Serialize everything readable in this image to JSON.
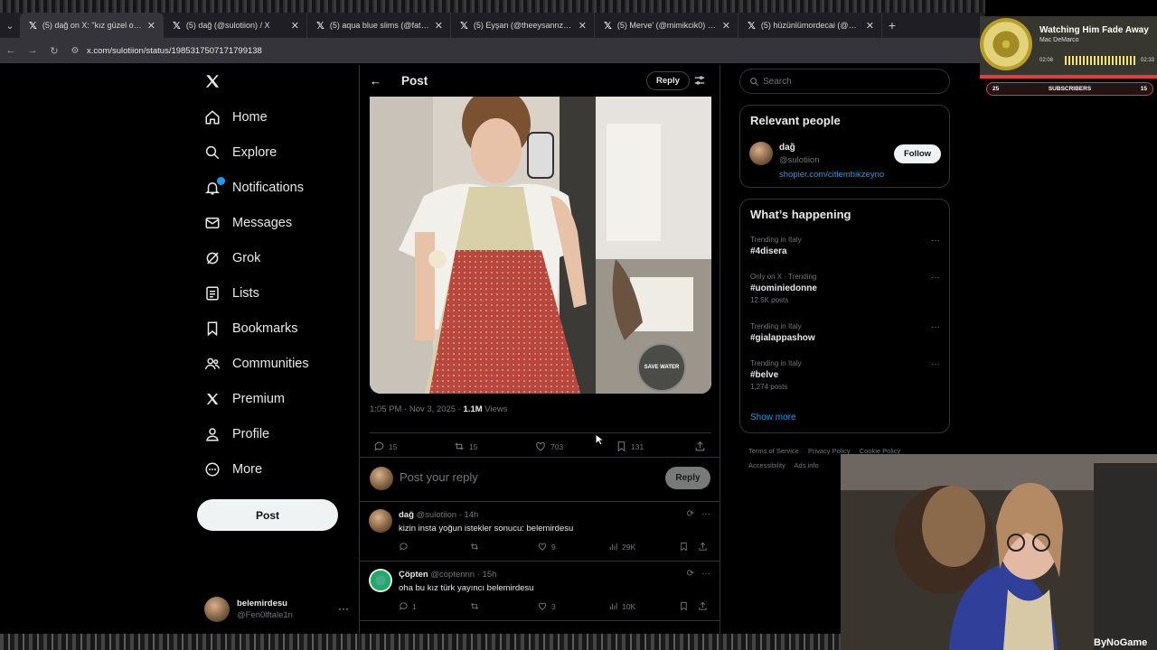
{
  "browser": {
    "tabs": [
      {
        "title": "(5) dağ on X: \"kız güzel olduğu",
        "active": true
      },
      {
        "title": "(5) dağ (@sulotiion) / X",
        "active": false
      },
      {
        "title": "(5) aqua blue slims (@fatosoni",
        "active": false
      },
      {
        "title": "(5) Eyşan (@theeysannz) / X",
        "active": false
      },
      {
        "title": "(5) Merve' (@mimikcik0) / X",
        "active": false
      },
      {
        "title": "(5) hüzünlümordecai (@melan",
        "active": false
      }
    ],
    "url": "x.com/sulotiion/status/1985317507171799138"
  },
  "nav": {
    "items": [
      {
        "label": "Home",
        "icon": "home-icon"
      },
      {
        "label": "Explore",
        "icon": "search-icon"
      },
      {
        "label": "Notifications",
        "icon": "bell-icon"
      },
      {
        "label": "Messages",
        "icon": "mail-icon"
      },
      {
        "label": "Grok",
        "icon": "grok-icon"
      },
      {
        "label": "Lists",
        "icon": "list-icon"
      },
      {
        "label": "Bookmarks",
        "icon": "bookmark-icon"
      },
      {
        "label": "Communities",
        "icon": "people-icon"
      },
      {
        "label": "Premium",
        "icon": "x-icon"
      },
      {
        "label": "Profile",
        "icon": "person-icon"
      },
      {
        "label": "More",
        "icon": "more-icon"
      }
    ],
    "post_label": "Post",
    "account": {
      "name": "belemirdesu",
      "handle": "@Fen0lftale1n"
    }
  },
  "post": {
    "header_title": "Post",
    "reply_top_label": "Reply",
    "time": "1:05 PM",
    "date": "Nov 3, 2025",
    "views_count": "1.1M",
    "views_label": "Views",
    "replies": "15",
    "reposts": "15",
    "likes": "703",
    "bookmarks": "131",
    "reply_placeholder": "Post your reply",
    "reply_button": "Reply",
    "media_badge": "SAVE WATER"
  },
  "comments": [
    {
      "name": "dağ",
      "handle": "@sulotiion",
      "time": "14h",
      "text": "kizin insta yoğun istekler sonucu: belemirdesu",
      "replies": "",
      "reposts": "",
      "likes": "9",
      "views": "29K"
    },
    {
      "name": "Çöpten",
      "handle": "@coptennn",
      "time": "15h",
      "text": "oha bu kız türk yayıncı belemirdesu",
      "replies": "1",
      "reposts": "",
      "likes": "3",
      "views": "10K"
    }
  ],
  "sidebar": {
    "search_placeholder": "Search",
    "relevant_title": "Relevant people",
    "person": {
      "name": "dağ",
      "handle": "@sulotiion",
      "link": "shopier.com/citlembikzeyno"
    },
    "follow_label": "Follow",
    "happening_title": "What’s happening",
    "trends": [
      {
        "meta": "Trending in Italy",
        "tag": "#4disera",
        "count": ""
      },
      {
        "meta": "Only on X · Trending",
        "tag": "#uominiedonne",
        "count": "12.5K posts"
      },
      {
        "meta": "Trending in Italy",
        "tag": "#gialappashow",
        "count": ""
      },
      {
        "meta": "Trending in Italy",
        "tag": "#belve",
        "count": "1,274 posts"
      }
    ],
    "show_more": "Show more",
    "footer": [
      "Terms of Service",
      "Privacy Policy",
      "Cookie Policy",
      "Accessibility",
      "Ads info"
    ]
  },
  "stream": {
    "track": "Watching Him Fade Away",
    "artist": "Mac DeMarco",
    "time_start": "02:08",
    "time_end": "02:33",
    "subs_left": "25",
    "subs_label": "SUBSCRIBERS",
    "subs_right": "15",
    "watermark": "ByNoGame"
  },
  "colors": {
    "accent": "#1d9bf0",
    "background": "#000000",
    "muted": "#71767b",
    "text": "#e7e9ea"
  }
}
